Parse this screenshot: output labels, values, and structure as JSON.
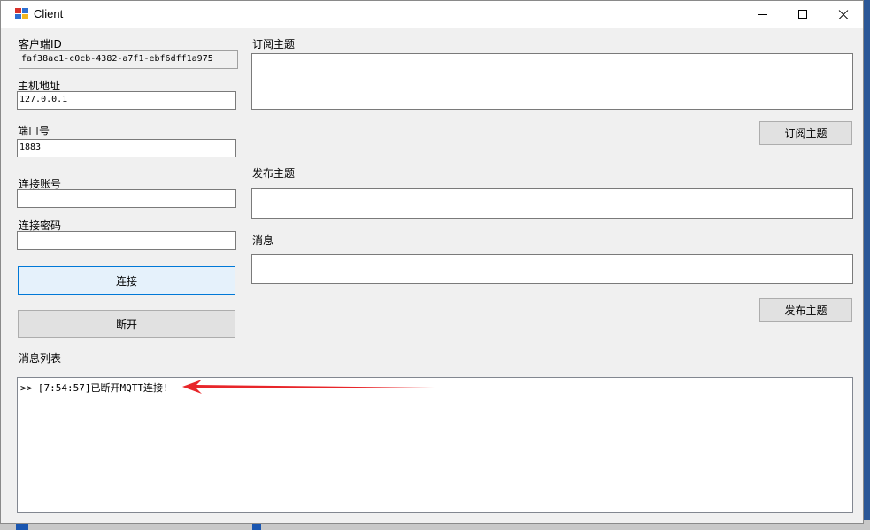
{
  "window": {
    "title": "Client",
    "icon": "windows-form-icon"
  },
  "fields": {
    "client_id": {
      "label": "客户端ID",
      "value": "faf38ac1-c0cb-4382-a7f1-ebf6dff1a975"
    },
    "host": {
      "label": "主机地址",
      "value": "127.0.0.1"
    },
    "port": {
      "label": "端口号",
      "value": "1883"
    },
    "username": {
      "label": "连接账号",
      "value": ""
    },
    "password": {
      "label": "连接密码",
      "value": ""
    },
    "subscribe_topic": {
      "label": "订阅主题",
      "value": ""
    },
    "publish_topic": {
      "label": "发布主题",
      "value": ""
    },
    "message": {
      "label": "消息",
      "value": ""
    }
  },
  "buttons": {
    "connect": "连接",
    "disconnect": "断开",
    "subscribe": "订阅主题",
    "publish": "发布主题"
  },
  "message_list": {
    "label": "消息列表",
    "items": [
      ">> [7:54:57]已断开MQTT连接!"
    ]
  },
  "colors": {
    "accent": "#0078d7",
    "annotation_arrow": "#e8262a"
  }
}
